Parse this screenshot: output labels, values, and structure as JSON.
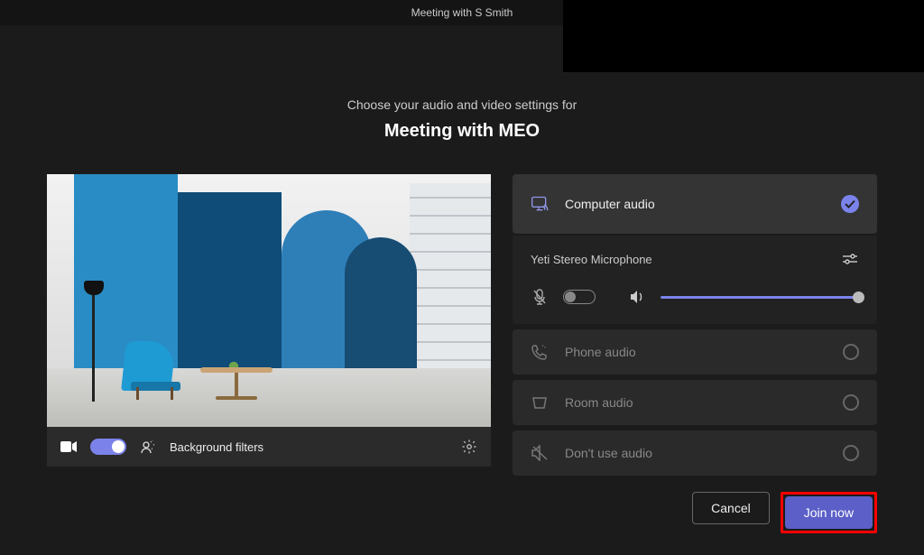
{
  "titlebar": {
    "title": "Meeting with S Smith"
  },
  "headings": {
    "subtitle": "Choose your audio and video settings for",
    "meeting_name": "Meeting with MEO"
  },
  "controls": {
    "video_on": true,
    "background_filters_label": "Background filters"
  },
  "audio": {
    "computer": {
      "label": "Computer audio",
      "selected": true
    },
    "device_name": "Yeti Stereo Microphone",
    "mic_on": false,
    "volume_pct": 100,
    "phone": {
      "label": "Phone audio"
    },
    "room": {
      "label": "Room audio"
    },
    "none": {
      "label": "Don't use audio"
    }
  },
  "buttons": {
    "cancel": "Cancel",
    "join": "Join now"
  },
  "colors": {
    "accent": "#7b83eb",
    "primary_btn": "#5b5fc7"
  }
}
